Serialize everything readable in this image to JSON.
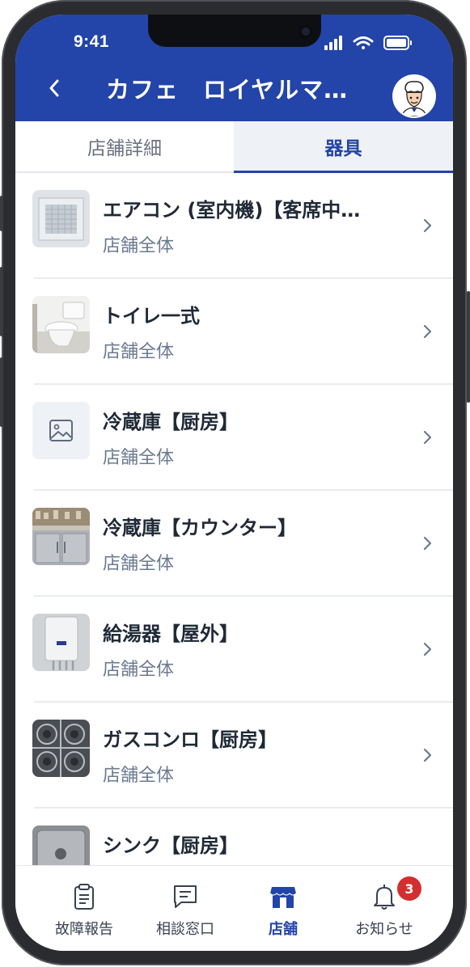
{
  "status_bar": {
    "time": "9:41"
  },
  "header": {
    "title": "カフェ　ロイヤルマ…",
    "back_icon": "chevron-left-icon",
    "avatar_icon": "chef-avatar-icon"
  },
  "tabs": [
    {
      "label": "店舗詳細",
      "active": false
    },
    {
      "label": "器具",
      "active": true
    }
  ],
  "equipment": [
    {
      "name": "エアコン (室内機)【客席中…",
      "location": "店舗全体",
      "thumb": "air-conditioner"
    },
    {
      "name": "トイレ一式",
      "location": "店舗全体",
      "thumb": "toilet"
    },
    {
      "name": "冷蔵庫【厨房】",
      "location": "店舗全体",
      "thumb": "placeholder-image"
    },
    {
      "name": "冷蔵庫【カウンター】",
      "location": "店舗全体",
      "thumb": "counter-fridge"
    },
    {
      "name": "給湯器【屋外】",
      "location": "店舗全体",
      "thumb": "water-heater"
    },
    {
      "name": "ガスコンロ【厨房】",
      "location": "店舗全体",
      "thumb": "gas-stove"
    },
    {
      "name": "シンク【厨房】",
      "location": "",
      "thumb": "sink"
    }
  ],
  "bottom_nav": [
    {
      "label": "故障報告",
      "icon": "clipboard-icon",
      "active": false
    },
    {
      "label": "相談窓口",
      "icon": "chat-icon",
      "active": false
    },
    {
      "label": "店舗",
      "icon": "store-icon",
      "active": true
    },
    {
      "label": "お知らせ",
      "icon": "bell-icon",
      "active": false,
      "badge": "3"
    }
  ],
  "colors": {
    "primary": "#2344a8",
    "badge": "#d32f2f",
    "text": "#1f2937",
    "muted": "#6b7a90"
  }
}
